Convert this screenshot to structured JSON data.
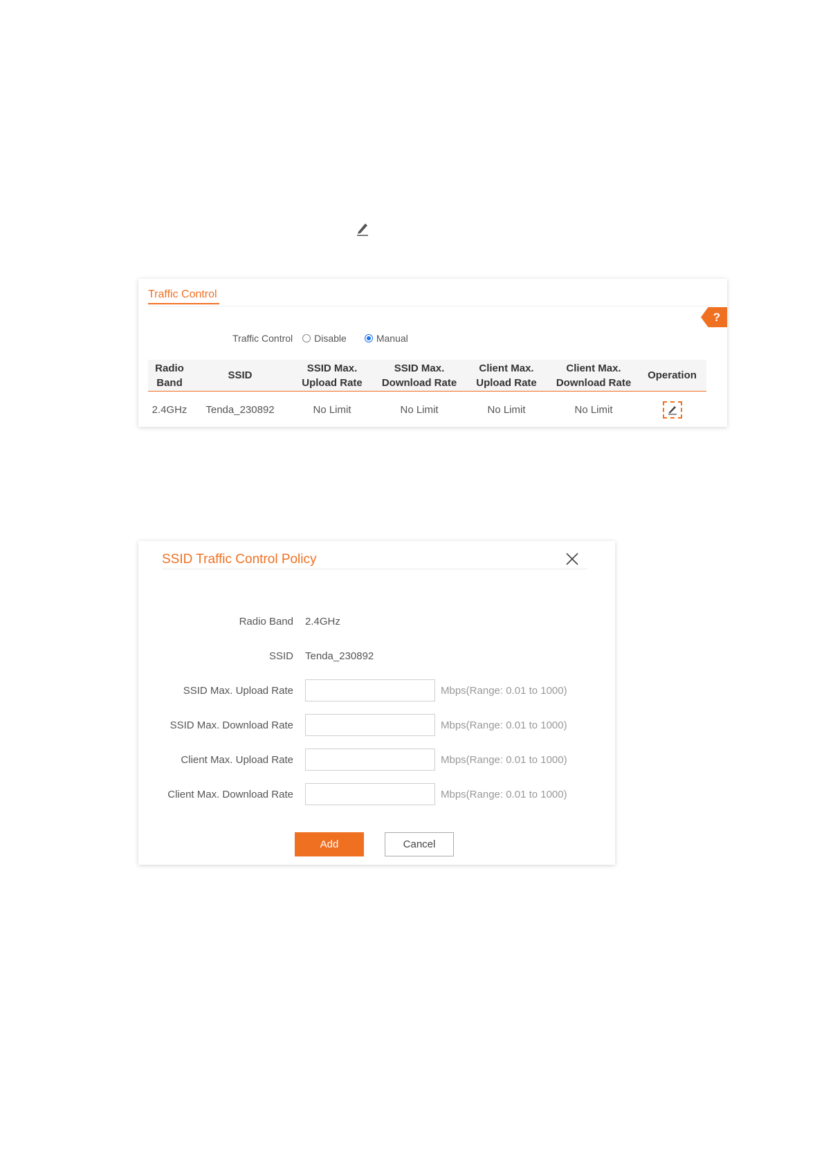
{
  "traffic_control": {
    "title": "Traffic Control",
    "help_label": "?",
    "mode_label": "Traffic Control",
    "options": [
      {
        "label": "Disable",
        "selected": false
      },
      {
        "label": "Manual",
        "selected": true
      }
    ],
    "table": {
      "headers": [
        [
          "Radio",
          "Band"
        ],
        [
          "SSID"
        ],
        [
          "SSID Max.",
          "Upload Rate"
        ],
        [
          "SSID Max.",
          "Download Rate"
        ],
        [
          "Client Max.",
          "Upload Rate"
        ],
        [
          "Client Max.",
          "Download Rate"
        ],
        [
          "Operation"
        ]
      ],
      "rows": [
        [
          "2.4GHz",
          "Tenda_230892",
          "No Limit",
          "No Limit",
          "No Limit",
          "No Limit"
        ]
      ]
    }
  },
  "dialog": {
    "title": "SSID Traffic Control Policy",
    "radio_band_label": "Radio Band",
    "radio_band_value": "2.4GHz",
    "ssid_label": "SSID",
    "ssid_value": "Tenda_230892",
    "fields": [
      {
        "label": "SSID Max. Upload Rate",
        "value": "",
        "hint": "Mbps(Range: 0.01 to 1000)"
      },
      {
        "label": "SSID Max. Download Rate",
        "value": "",
        "hint": "Mbps(Range: 0.01 to 1000)"
      },
      {
        "label": "Client Max. Upload Rate",
        "value": "",
        "hint": "Mbps(Range: 0.01 to 1000)"
      },
      {
        "label": "Client Max. Download Rate",
        "value": "",
        "hint": "Mbps(Range: 0.01 to 1000)"
      }
    ],
    "add_label": "Add",
    "cancel_label": "Cancel"
  },
  "icons": {
    "top": "pencil-icon",
    "operation": "edit-icon",
    "close": "close-icon"
  },
  "colors": {
    "accent": "#f07022",
    "radio_selected": "#1a73e8"
  }
}
